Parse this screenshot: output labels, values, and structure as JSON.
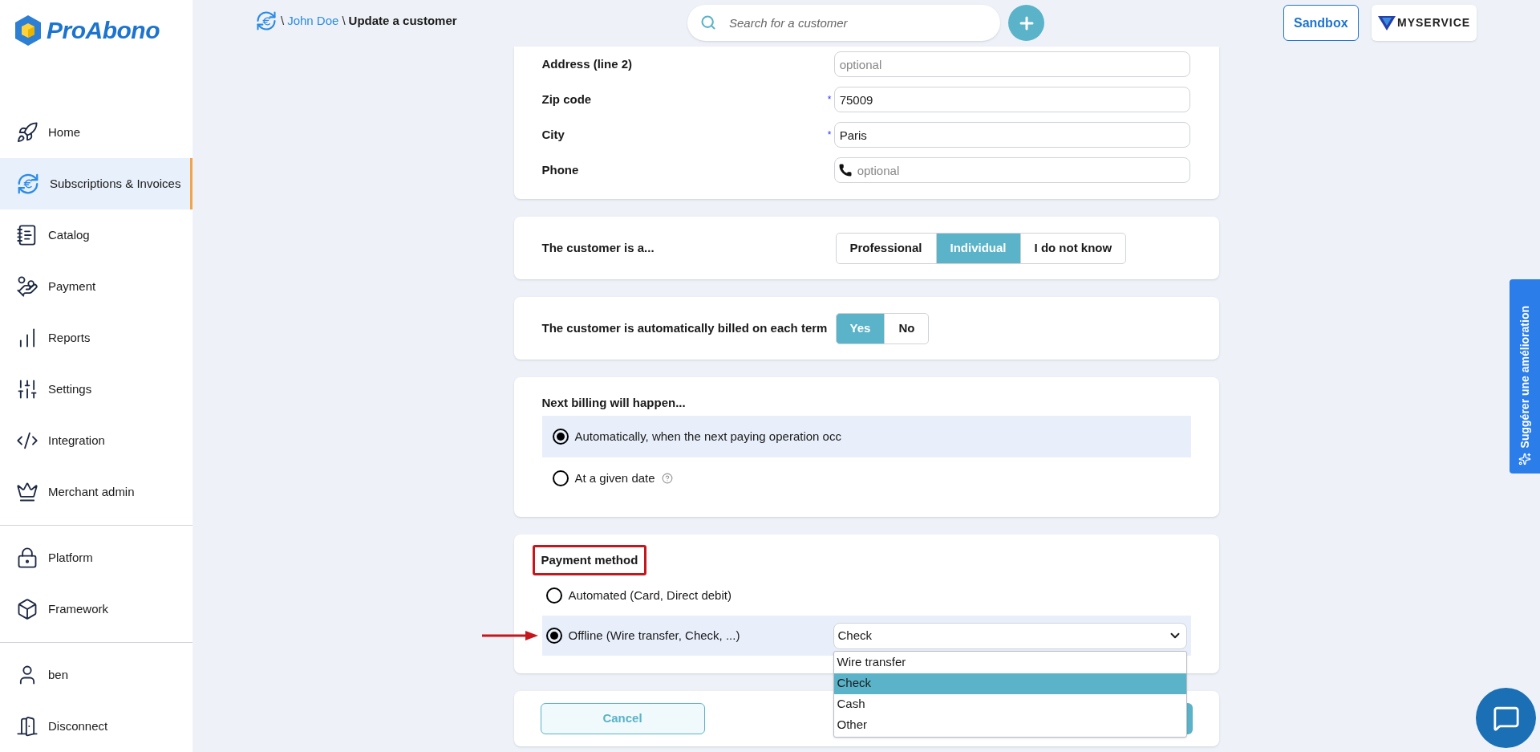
{
  "sidebar": {
    "logo": "ProAbono",
    "sections": [
      {
        "items": [
          {
            "label": "Home",
            "selected": false
          },
          {
            "label": "Subscriptions & Invoices",
            "selected": true
          },
          {
            "label": "Catalog",
            "selected": false
          },
          {
            "label": "Payment",
            "selected": false
          },
          {
            "label": "Reports",
            "selected": false
          },
          {
            "label": "Settings",
            "selected": false
          },
          {
            "label": "Integration",
            "selected": false
          },
          {
            "label": "Merchant admin",
            "selected": false
          }
        ]
      },
      {
        "items": [
          {
            "label": "Platform",
            "selected": false
          },
          {
            "label": "Framework",
            "selected": false
          }
        ]
      },
      {
        "items": [
          {
            "label": "ben",
            "selected": false
          },
          {
            "label": "Disconnect",
            "selected": false
          }
        ]
      }
    ]
  },
  "header": {
    "breadcrumb": [
      {
        "separator": "\\",
        "label": "John Doe",
        "kind": "link"
      },
      {
        "separator": "\\",
        "label": "Update a customer",
        "kind": "current"
      }
    ],
    "search": {
      "placeholder": "Search for a customer"
    },
    "sandbox_button": "Sandbox",
    "account_logo": "MYSERVICE"
  },
  "address_card": {
    "fields": [
      {
        "label": "Address (line 2)",
        "required": false,
        "kind": "text",
        "placeholder": "optional"
      },
      {
        "label": "Zip code",
        "required": true,
        "required_mark": "*",
        "kind": "text",
        "value": "75009"
      },
      {
        "label": "City",
        "required": true,
        "required_mark": "*",
        "kind": "text",
        "value": "Paris"
      },
      {
        "label": "Phone",
        "required": false,
        "kind": "phone",
        "placeholder": "optional"
      }
    ]
  },
  "customer_type": {
    "label": "The customer is a...",
    "options": [
      {
        "label": "Professional",
        "selected": false
      },
      {
        "label": "Individual",
        "selected": true
      },
      {
        "label": "I do not know",
        "selected": false
      }
    ]
  },
  "auto_billing": {
    "label": "The customer is automatically billed on each term",
    "options": [
      {
        "label": "Yes",
        "selected": true
      },
      {
        "label": "No",
        "selected": false
      }
    ]
  },
  "next_billing": {
    "title": "Next billing will happen...",
    "options": [
      {
        "label": "Automatically, when the next paying operation occ",
        "selected": true,
        "help": false
      },
      {
        "label": "At a given date",
        "selected": false,
        "help": true
      }
    ]
  },
  "payment_method": {
    "title": "Payment method",
    "title_highlighted": true,
    "options": [
      {
        "label": "Automated (Card, Direct debit)",
        "selected": false,
        "arrow": false
      },
      {
        "label": "Offline (Wire transfer, Check, ...)",
        "selected": true,
        "arrow": true
      }
    ],
    "select": {
      "value": "Check",
      "expanded": true,
      "options": [
        {
          "label": "Wire transfer",
          "selected": false
        },
        {
          "label": "Check",
          "selected": true
        },
        {
          "label": "Cash",
          "selected": false
        },
        {
          "label": "Other",
          "selected": false
        }
      ]
    }
  },
  "actions": {
    "cancel": "Cancel"
  },
  "feedback_tab": "Suggérer une amélioration"
}
